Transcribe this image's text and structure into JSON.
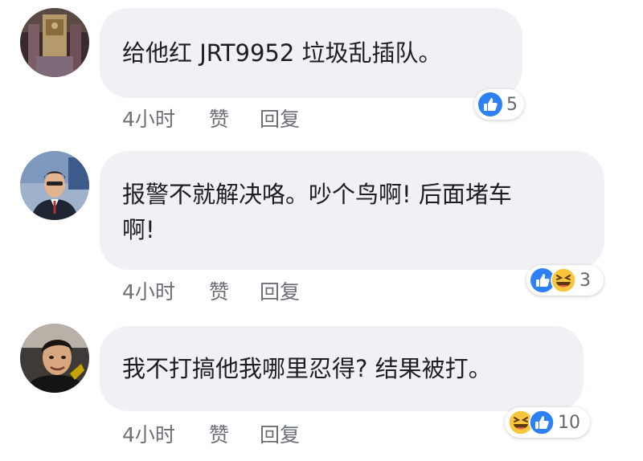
{
  "colors": {
    "bubble_bg": "#eff1f4",
    "meta_text": "#6b6f76",
    "like_blue": "#2e80f5",
    "haha_yellow": "#f7c63b"
  },
  "comments": [
    {
      "text": "给他红 JRT9952 垃圾乱插队。",
      "time": "4小时",
      "like_label": "赞",
      "reply_label": "回复",
      "reactions": [
        "like"
      ],
      "reaction_count": "5"
    },
    {
      "text_line1": "报警不就解决咯。吵个鸟啊! 后面堵车",
      "text_line2": "啊!",
      "time": "4小时",
      "like_label": "赞",
      "reply_label": "回复",
      "reactions": [
        "like",
        "haha"
      ],
      "reaction_count": "3"
    },
    {
      "text": "我不打搞他我哪里忍得? 结果被打。",
      "time": "4小时",
      "like_label": "赞",
      "reply_label": "回复",
      "reactions": [
        "haha",
        "like"
      ],
      "reaction_count": "10"
    }
  ]
}
